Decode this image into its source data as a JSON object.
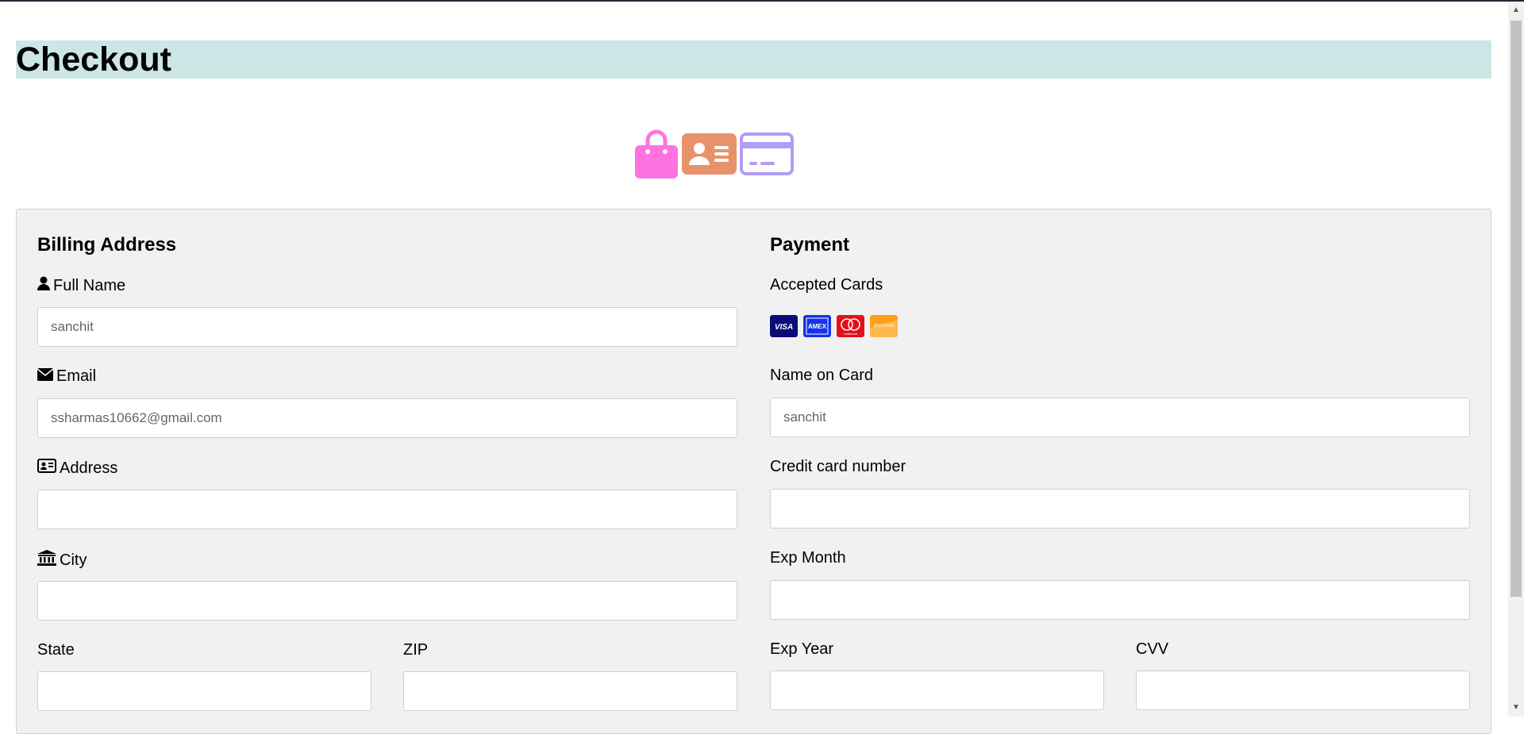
{
  "page": {
    "title": "Checkout"
  },
  "colors": {
    "header_bg": "#cce6e6",
    "panel_bg": "#f1f1f1",
    "bag_icon": "#ff73e0",
    "id_icon": "#e8926a",
    "card_icon": "#b19cf7"
  },
  "hero_icons": [
    "shopping-bag-icon",
    "address-card-icon",
    "credit-card-icon"
  ],
  "billing": {
    "title": "Billing Address",
    "full_name": {
      "label": "Full Name",
      "value": "sanchit",
      "icon": "user-icon"
    },
    "email": {
      "label": "Email",
      "value": "ssharmas10662@gmail.com",
      "icon": "envelope-icon"
    },
    "address": {
      "label": "Address",
      "value": "",
      "icon": "address-card-icon"
    },
    "city": {
      "label": "City",
      "value": "",
      "icon": "institution-icon"
    },
    "state": {
      "label": "State",
      "value": ""
    },
    "zip": {
      "label": "ZIP",
      "value": ""
    }
  },
  "payment": {
    "title": "Payment",
    "accepted_cards_label": "Accepted Cards",
    "cards": [
      "VISA",
      "AMEX",
      "mastercard",
      "DISCOVER"
    ],
    "name_on_card": {
      "label": "Name on Card",
      "value": "sanchit"
    },
    "card_number": {
      "label": "Credit card number",
      "value": ""
    },
    "exp_month": {
      "label": "Exp Month",
      "value": ""
    },
    "exp_year": {
      "label": "Exp Year",
      "value": ""
    },
    "cvv": {
      "label": "CVV",
      "value": ""
    }
  }
}
